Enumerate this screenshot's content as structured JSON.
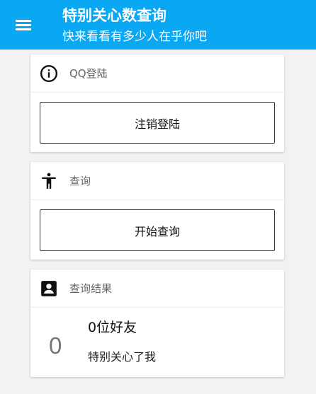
{
  "appbar": {
    "title": "特别关心数查询",
    "subtitle": "快来看看有多少人在乎你吧",
    "menu_icon": "menu-icon",
    "background": "#0aa7f2"
  },
  "cards": {
    "login": {
      "icon": "info-icon",
      "title": "QQ登陆",
      "button_label": "注销登陆"
    },
    "query": {
      "icon": "accessibility-icon",
      "title": "查询",
      "button_label": "开始查询"
    },
    "result": {
      "icon": "contact-card-icon",
      "title": "查询结果",
      "count": "0",
      "friends_text": "0位好友",
      "care_text": "特别关心了我"
    }
  }
}
